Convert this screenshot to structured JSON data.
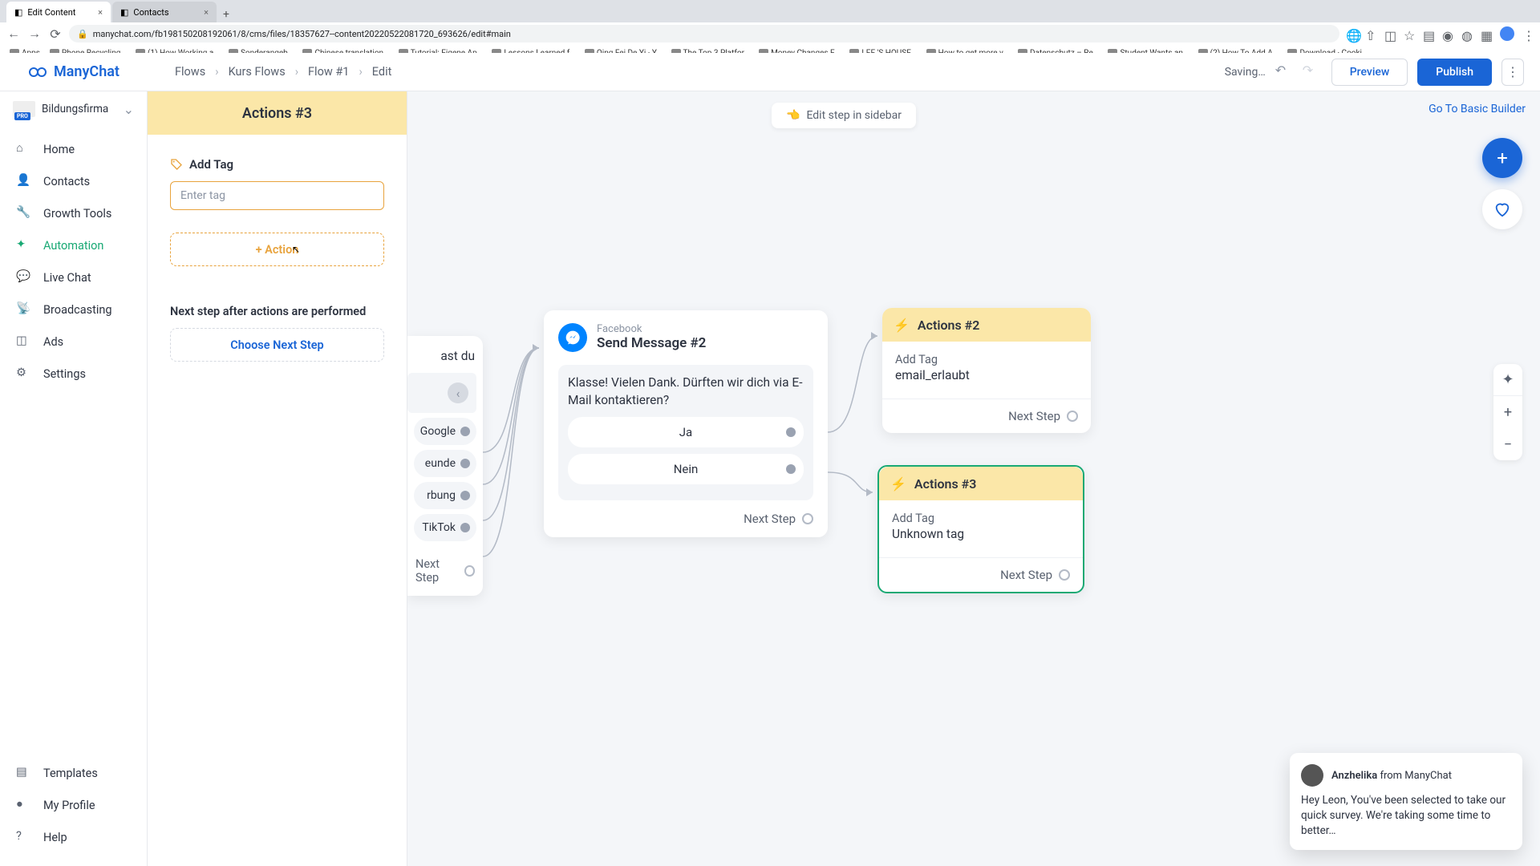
{
  "browser": {
    "tabs": [
      {
        "title": "Edit Content",
        "active": true
      },
      {
        "title": "Contacts",
        "active": false
      }
    ],
    "url": "manychat.com/fb198150208192061/8/cms/files/18357627--content20220522081720_693626/edit#main",
    "bookmarks": [
      "Apps",
      "Phone Recycling…",
      "(1) How Working a…",
      "Sonderangeb…",
      "Chinese translation…",
      "Tutorial: Eigene Ap…",
      "Lessons Learned f…",
      "Qing Fei De Yi · Y…",
      "The Top 3 Platfor…",
      "Money Changes E…",
      "LEE 'S HOUSE…",
      "How to get more v…",
      "Datenschutz – Re…",
      "Student Wants an…",
      "(2) How To Add A…",
      "Download · Cooki…"
    ]
  },
  "app": {
    "brand": "ManyChat",
    "breadcrumb": [
      "Flows",
      "Kurs Flows",
      "Flow #1",
      "Edit"
    ],
    "saving": "Saving…",
    "preview": "Preview",
    "publish": "Publish",
    "edit_in_sidebar": "Edit step in sidebar",
    "goto_basic": "Go To Basic Builder"
  },
  "workspace": {
    "name": "Bildungsfirma",
    "badge": "PRO"
  },
  "nav": {
    "items": [
      "Home",
      "Contacts",
      "Growth Tools",
      "Automation",
      "Live Chat",
      "Broadcasting",
      "Ads",
      "Settings"
    ],
    "bottom": [
      "Templates",
      "My Profile",
      "Help"
    ],
    "active": "Automation"
  },
  "editor": {
    "title": "Actions #3",
    "tag_label": "Add Tag",
    "tag_placeholder": "Enter tag",
    "add_action": "+ Action",
    "next_label": "Next step after actions are performed",
    "choose_next": "Choose Next Step"
  },
  "flow": {
    "partial": {
      "prompt_tail": "ast du",
      "options": [
        "Google",
        "eunde",
        "rbung",
        "TikTok"
      ],
      "next": "Next Step"
    },
    "msg": {
      "platform": "Facebook",
      "title": "Send Message #2",
      "text": "Klasse! Vielen Dank. Dürften wir dich via E-Mail kontaktieren?",
      "opt1": "Ja",
      "opt2": "Nein",
      "next": "Next Step"
    },
    "act2": {
      "title": "Actions #2",
      "tag_label": "Add Tag",
      "tag_value": "email_erlaubt",
      "next": "Next Step"
    },
    "act3": {
      "title": "Actions #3",
      "tag_label": "Add Tag",
      "tag_value": "Unknown tag",
      "next": "Next Step"
    }
  },
  "chat": {
    "name": "Anzhelika",
    "from": " from ManyChat",
    "msg": "Hey Leon,  You've been selected to take our quick survey. We're taking some time to better…"
  }
}
